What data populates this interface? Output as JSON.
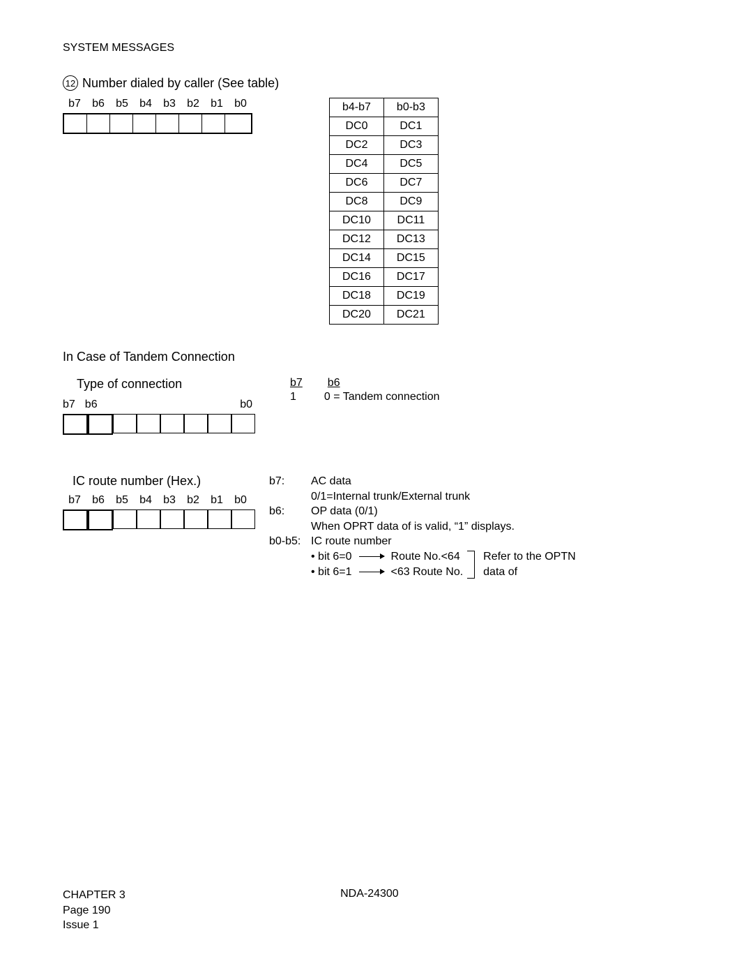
{
  "header": "SYSTEM MESSAGES",
  "section12": {
    "marker": "12",
    "title": "Number dialed by caller (See table)",
    "bits": [
      "b7",
      "b6",
      "b5",
      "b4",
      "b3",
      "b2",
      "b1",
      "b0"
    ]
  },
  "dcTable": {
    "head": [
      "b4-b7",
      "b0-b3"
    ],
    "rows": [
      [
        "DC0",
        "DC1"
      ],
      [
        "DC2",
        "DC3"
      ],
      [
        "DC4",
        "DC5"
      ],
      [
        "DC6",
        "DC7"
      ],
      [
        "DC8",
        "DC9"
      ],
      [
        "DC10",
        "DC11"
      ],
      [
        "DC12",
        "DC13"
      ],
      [
        "DC14",
        "DC15"
      ],
      [
        "DC16",
        "DC17"
      ],
      [
        "DC18",
        "DC19"
      ],
      [
        "DC20",
        "DC21"
      ]
    ]
  },
  "tandem": {
    "heading": "In Case of Tandem Connection",
    "typeTitle": "Type of connection",
    "labels": {
      "b7": "b7",
      "b6": "b6",
      "b0": "b0"
    },
    "desc": {
      "h_b7": "b7",
      "h_b6": "b6",
      "v_b7": "1",
      "v_b6": "0 = Tandem connection"
    }
  },
  "ic": {
    "heading": "IC route number (Hex.)",
    "bits": [
      "b7",
      "b6",
      "b5",
      "b4",
      "b3",
      "b2",
      "b1",
      "b0"
    ],
    "b7": {
      "lbl": "b7:",
      "txt": "AC data"
    },
    "b7_2": "0/1=Internal trunk/External trunk",
    "b6": {
      "lbl": "b6:",
      "txt": "OP data (0/1)"
    },
    "b6_2": "When OPRT data of   is valid, “1” displays.",
    "b05": {
      "lbl": "b0-b5:",
      "txt": "IC route number"
    },
    "bullet1_a": "• bit 6=0",
    "bullet1_b": "Route No.<64",
    "bullet2_a": "• bit 6=1",
    "bullet2_b": "<63 Route No.",
    "refer1": "Refer to the OPTN",
    "refer2": "data of"
  },
  "footer": {
    "chapter": "CHAPTER 3",
    "page": "Page 190",
    "issue": "Issue 1",
    "doc": "NDA-24300"
  }
}
